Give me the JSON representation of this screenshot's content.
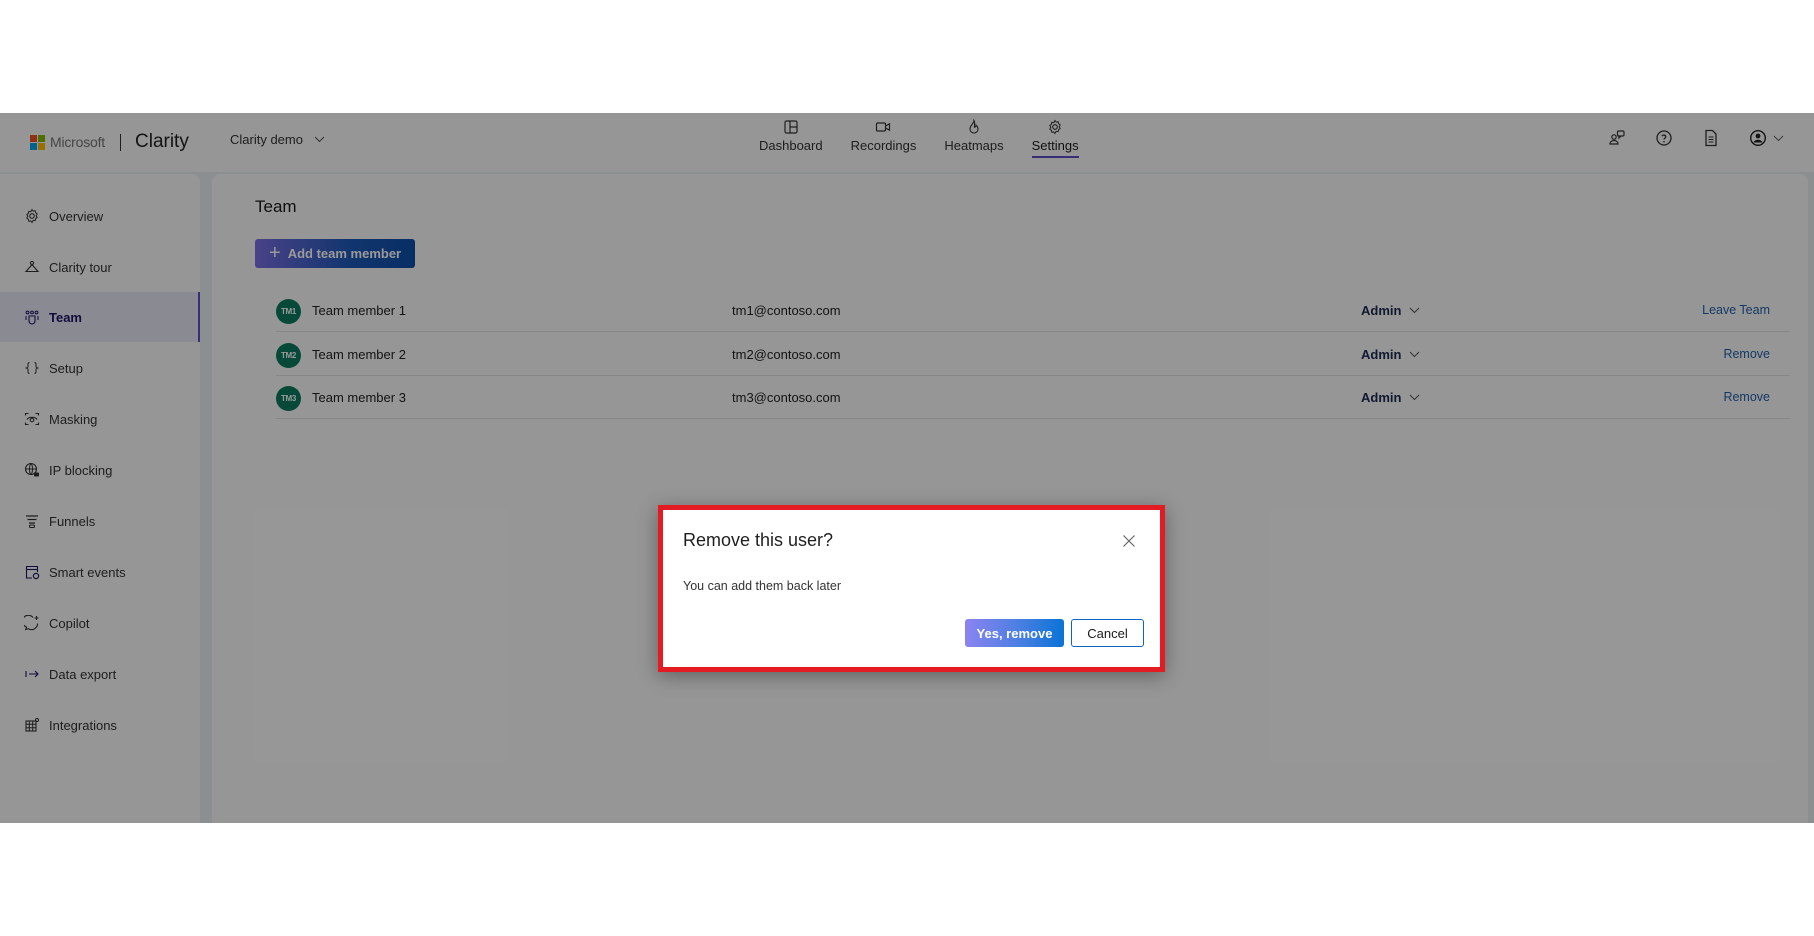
{
  "header": {
    "brand_microsoft": "Microsoft",
    "brand_product": "Clarity",
    "project_name": "Clarity demo",
    "nav": [
      {
        "label": "Dashboard",
        "icon": "dashboard-icon"
      },
      {
        "label": "Recordings",
        "icon": "video-icon"
      },
      {
        "label": "Heatmaps",
        "icon": "flame-icon"
      },
      {
        "label": "Settings",
        "icon": "gear-icon",
        "active": true
      }
    ],
    "actions": [
      "feedback-icon",
      "help-icon",
      "document-icon",
      "account-icon"
    ]
  },
  "sidebar": {
    "items": [
      {
        "label": "Overview",
        "icon": "gear-icon"
      },
      {
        "label": "Clarity tour",
        "icon": "hanger-icon"
      },
      {
        "label": "Team",
        "icon": "people-icon",
        "active": true
      },
      {
        "label": "Setup",
        "icon": "braces-icon"
      },
      {
        "label": "Masking",
        "icon": "eye-scan-icon"
      },
      {
        "label": "IP blocking",
        "icon": "globe-lock-icon"
      },
      {
        "label": "Funnels",
        "icon": "funnel-icon"
      },
      {
        "label": "Smart events",
        "icon": "calendar-gear-icon"
      },
      {
        "label": "Copilot",
        "icon": "copilot-icon"
      },
      {
        "label": "Data export",
        "icon": "export-arrow-icon"
      },
      {
        "label": "Integrations",
        "icon": "grid-plus-icon"
      }
    ]
  },
  "main": {
    "title": "Team",
    "add_button": "Add team member",
    "members": [
      {
        "initials": "TM1",
        "name": "Team member 1",
        "email": "tm1@contoso.com",
        "role": "Admin",
        "action": "Leave Team"
      },
      {
        "initials": "TM2",
        "name": "Team member 2",
        "email": "tm2@contoso.com",
        "role": "Admin",
        "action": "Remove"
      },
      {
        "initials": "TM3",
        "name": "Team member 3",
        "email": "tm3@contoso.com",
        "role": "Admin",
        "action": "Remove"
      }
    ]
  },
  "dialog": {
    "title": "Remove this user?",
    "body": "You can add them back later",
    "confirm": "Yes, remove",
    "cancel": "Cancel"
  },
  "colors": {
    "accent": "#5b4fc4",
    "avatar": "#0b7b5f",
    "link": "#1e5fa8",
    "highlight_border": "#e31b23"
  }
}
